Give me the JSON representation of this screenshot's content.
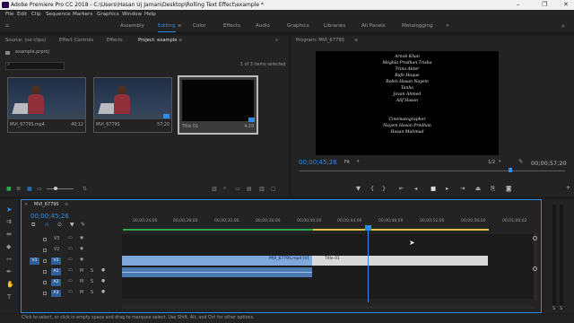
{
  "window": {
    "title": "Adobe Premiere Pro CC 2018 - C:\\Users\\Hasan Uj Jaman\\Desktop\\Rolling Text Effect\\example *",
    "controls": [
      "–",
      "❐",
      "✕"
    ]
  },
  "menu": [
    "File",
    "Edit",
    "Clip",
    "Sequence",
    "Markers",
    "Graphics",
    "Window",
    "Help"
  ],
  "workspaces": [
    "Assembly",
    "Editing",
    "Color",
    "Effects",
    "Audio",
    "Graphics",
    "Libraries",
    "All Panels",
    "Metalogging"
  ],
  "active_workspace": "Editing",
  "source_panel": {
    "tabs": [
      "Source: (no clips)",
      "Effect Controls",
      "Effects",
      "Project: example"
    ],
    "active_tab": "Project: example",
    "project_file": "example.prproj",
    "items_count": "1 of 3 items selected",
    "items": [
      {
        "name": "MVI_6779S.mp4",
        "duration": "40;12"
      },
      {
        "name": "MVI_6779S",
        "duration": "57;20"
      },
      {
        "name": "Title 01",
        "duration": "4;29"
      }
    ]
  },
  "program_panel": {
    "tab": "Program: MVI_6779S",
    "timecode_left": "00;00;45;26",
    "fit": "Fit",
    "resolution": "1/2",
    "timecode_right": "00;00;57;20"
  },
  "credits": [
    "Arnob Khan",
    "Meghla Prodhan Trisha",
    "Trina Akter",
    "Rafe Haque",
    "Robin Hasan Nayem",
    "Tanha",
    "Jovan Ahmed",
    "Alif Hasan",
    "",
    "",
    "Cinematographer",
    "Nayem Hasan Prodhan",
    "Hasan Mahmud"
  ],
  "timeline": {
    "tab": "MVI_6779S",
    "timecode": "00;00;45;26",
    "ruler": [
      "00;00;24;00",
      "00;00;28;00",
      "00;00;32;00",
      "00;00;36;00",
      "00;00;40;00",
      "00;00;44;00",
      "00;00;48;00",
      "00;00;52;00",
      "00;00;56;00",
      "00;01;00;02"
    ],
    "tracks": [
      {
        "name": "V3"
      },
      {
        "name": "V2"
      },
      {
        "name": "V1",
        "src": "V1"
      },
      {
        "name": "A1",
        "src": "A1"
      },
      {
        "name": "A2"
      },
      {
        "name": "A3"
      }
    ],
    "clips": [
      {
        "label": "MVI_6779S.mp4 [V]"
      },
      {
        "label": "Title 01"
      }
    ],
    "mute": "M",
    "solo": "S"
  },
  "status": "Click to select, or click in empty space and drag to marquee select. Use Shift, Alt, and Ctrl for other options.",
  "colors": {
    "accent": "#2d8ceb",
    "video_clip": "#7fa9dd",
    "title_clip": "#d9d9d9",
    "audio_clip": "#4c78b0",
    "playhead": "#2d8ceb"
  }
}
